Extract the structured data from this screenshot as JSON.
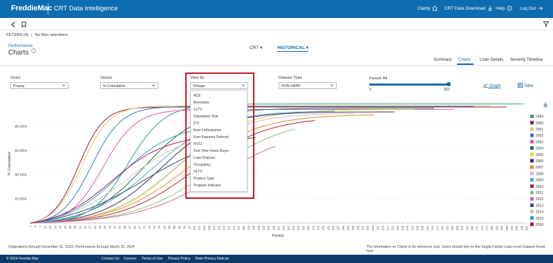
{
  "header": {
    "logo": "FreddieMac",
    "app_title": "CRT Data Intelligence",
    "nav": [
      {
        "label": "Clarity",
        "icon": "home-icon"
      },
      {
        "label": "CRT Data Download",
        "icon": "download-icon"
      },
      {
        "label": "Help",
        "icon": "help-icon"
      },
      {
        "label": "Log Out",
        "icon": "logout-icon"
      }
    ]
  },
  "filters": {
    "label": "FILTERS (0)",
    "value": "No filter selections"
  },
  "breadcrumb": "Performance",
  "page_title": "Charts",
  "dropdowns": {
    "crt": "CRT",
    "historical": "HISTORICAL"
  },
  "tabs": [
    {
      "label": "Summary",
      "active": false
    },
    {
      "label": "Charts",
      "active": true
    },
    {
      "label": "Loan Details",
      "active": false
    },
    {
      "label": "Severity Timeline",
      "active": false
    }
  ],
  "controls": {
    "chart": {
      "label": "Chart",
      "value": "Prepay"
    },
    "values": {
      "label": "Values",
      "value": "% Cumulative"
    },
    "view_by": {
      "label": "View By",
      "value": "Vintage"
    },
    "dataset": {
      "label": "Dataset Type",
      "value": "NON-HARP"
    },
    "period": {
      "label": "Period: All",
      "min": "0",
      "max": "301",
      "fill": 1.0
    },
    "view_graph": "Graph",
    "view_table": "Table"
  },
  "view_by_menu": [
    "ACE",
    "Borrowers",
    "CLTV",
    "Disposition Year",
    "DTI",
    "Ever Forbearance",
    "Ever Payment Deferral",
    "FICO",
    "First Time Home Buyer",
    "Loan Purpose",
    "Occupancy",
    "OLTV",
    "Product Type",
    "Program Indicator"
  ],
  "chart_data": {
    "type": "line",
    "title": "",
    "xlabel": "Period",
    "ylabel": "% Cumulative",
    "ylim": [
      0,
      100
    ],
    "yticks": [
      "20.00%",
      "40.00%",
      "60.00%",
      "80.00%"
    ],
    "ytick_values": [
      20,
      40,
      60,
      80
    ],
    "x_tick_labels": [
      "1",
      "4",
      "7",
      "10",
      "13",
      "16",
      "19",
      "22",
      "25",
      "28",
      "31",
      "34",
      "37",
      "40",
      "43",
      "46",
      "49",
      "52",
      "55",
      "58",
      "61",
      "64",
      "67",
      "70",
      "73",
      "76",
      "79",
      "82",
      "85",
      "88",
      "91",
      "94",
      "97",
      "100",
      "103",
      "106",
      "109",
      "112",
      "115",
      "118",
      "121",
      "124",
      "127",
      "130",
      "133",
      "136",
      "139",
      "142",
      "145",
      "148",
      "151",
      "154",
      "157",
      "160",
      "163",
      "166",
      "169",
      "172",
      "175",
      "178",
      "181",
      "184",
      "187",
      "190",
      "193",
      "196",
      "199",
      "202",
      "205",
      "208",
      "211",
      "214",
      "217",
      "220",
      "223",
      "226",
      "229",
      "232",
      "235",
      "238",
      "241",
      "244",
      "247",
      "250",
      "253",
      "256",
      "259",
      "262",
      "265",
      "268",
      "271",
      "274",
      "277",
      "280",
      "283",
      "286",
      "289",
      "292",
      "295",
      "298",
      "301"
    ],
    "legend_position": "right",
    "series": [
      {
        "name": "1999",
        "color": "#2a9d8f",
        "midpoint": 60,
        "steepness": 0.09,
        "final": 98.5,
        "end_period": 300
      },
      {
        "name": "2000",
        "color": "#8e1b4d",
        "midpoint": 30,
        "steepness": 0.13,
        "final": 96,
        "end_period": 290
      },
      {
        "name": "2001",
        "color": "#f4c06b",
        "midpoint": 32,
        "steepness": 0.12,
        "final": 97,
        "end_period": 280
      },
      {
        "name": "2002",
        "color": "#2b7bb9",
        "midpoint": 38,
        "steepness": 0.11,
        "final": 96.5,
        "end_period": 270
      },
      {
        "name": "2003",
        "color": "#e15aa0",
        "midpoint": 45,
        "steepness": 0.1,
        "final": 94,
        "end_period": 258
      },
      {
        "name": "2004",
        "color": "#1e6f58",
        "midpoint": 70,
        "steepness": 0.06,
        "final": 95,
        "end_period": 246
      },
      {
        "name": "2005",
        "color": "#d9d93a",
        "midpoint": 90,
        "steepness": 0.05,
        "final": 94,
        "end_period": 234
      },
      {
        "name": "2006",
        "color": "#3b2b5b",
        "midpoint": 80,
        "steepness": 0.055,
        "final": 92,
        "end_period": 222
      },
      {
        "name": "2007",
        "color": "#e8872b",
        "midpoint": 95,
        "steepness": 0.045,
        "final": 90,
        "end_period": 210
      },
      {
        "name": "2008",
        "color": "#c9b9c9",
        "midpoint": 88,
        "steepness": 0.05,
        "final": 91,
        "end_period": 198
      },
      {
        "name": "2009",
        "color": "#4ea3e0",
        "midpoint": 75,
        "steepness": 0.05,
        "final": 93,
        "end_period": 186
      },
      {
        "name": "2010",
        "color": "#b21f2d",
        "midpoint": 100,
        "steepness": 0.045,
        "final": 88,
        "end_period": 174
      },
      {
        "name": "2011",
        "color": "#7cc47c",
        "midpoint": 110,
        "steepness": 0.042,
        "final": 87,
        "end_period": 162
      },
      {
        "name": "2012",
        "color": "#c76ba0",
        "midpoint": 115,
        "steepness": 0.04,
        "final": 80,
        "end_period": 150
      },
      {
        "name": "2013",
        "color": "#2f4f6f",
        "midpoint": 70,
        "steepness": 0.04,
        "final": 76,
        "end_period": 138
      },
      {
        "name": "2014",
        "color": "#c7c7a0",
        "midpoint": 60,
        "steepness": 0.05,
        "final": 78,
        "end_period": 126
      },
      {
        "name": "2015",
        "color": "#1f9fcf",
        "midpoint": 55,
        "steepness": 0.06,
        "final": 82,
        "end_period": 114
      },
      {
        "name": "2016",
        "color": "#a4134c",
        "midpoint": 50,
        "steepness": 0.06,
        "final": 73,
        "end_period": 102
      }
    ]
  },
  "footnotes": {
    "left": "Originations through December 31, 2023; Performance through March 31, 2024",
    "right": "The information on Clarity is for reference only. Users should rely on the Single-Family Loan-Level Dataset found here"
  },
  "footer": {
    "copyright": "© 2024 Freddie Mac",
    "links": [
      "Contact Us",
      "Careers",
      "Terms of Use",
      "Privacy Policy",
      "State Privacy Notices"
    ]
  }
}
